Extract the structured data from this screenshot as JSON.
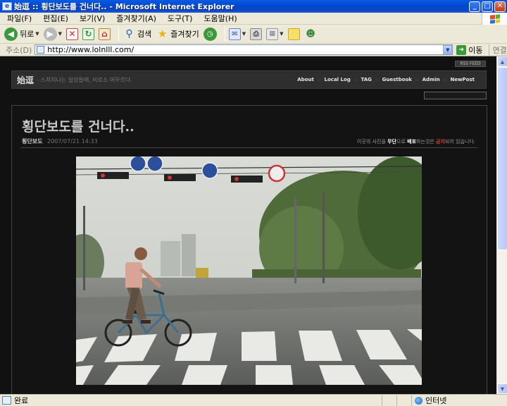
{
  "window": {
    "title": "始逗 :: 횡단보도를 건너다.. - Microsoft Internet Explorer",
    "app_icon": "ie-icon",
    "buttons": [
      "minimize",
      "maximize",
      "close"
    ]
  },
  "menu": [
    "파일(F)",
    "편집(E)",
    "보기(V)",
    "즐겨찾기(A)",
    "도구(T)",
    "도움말(H)"
  ],
  "toolbar": {
    "back_label": "뒤로",
    "search_label": "검색",
    "favorites_label": "즐겨찾기"
  },
  "address": {
    "label": "주소(D)",
    "url": "http://www.lolnlll.com/",
    "go_label": "이동",
    "links_label": "연결"
  },
  "blog": {
    "rss_label": "RSS FEED",
    "name": "始逗",
    "tagline": "- 스쳐지나는 일상들에, 비로소 머무르다.",
    "nav": [
      "About",
      "Local Log",
      "TAG",
      "Guestbook",
      "Admin",
      "NewPost"
    ],
    "nav_sep": "::"
  },
  "post": {
    "title": "횡단보도를 건너다..",
    "category": "횡단보도",
    "date": "2007/07/21 14:33",
    "notice_pre": "이곳의 사진을 ",
    "notice_w1": "무단",
    "notice_mid1": "으로 ",
    "notice_w2": "배포",
    "notice_mid2": "하는것은 ",
    "notice_r": "금지",
    "notice_post": "되어 있습니다."
  },
  "status": {
    "text": "완료",
    "zone": "인터넷"
  }
}
